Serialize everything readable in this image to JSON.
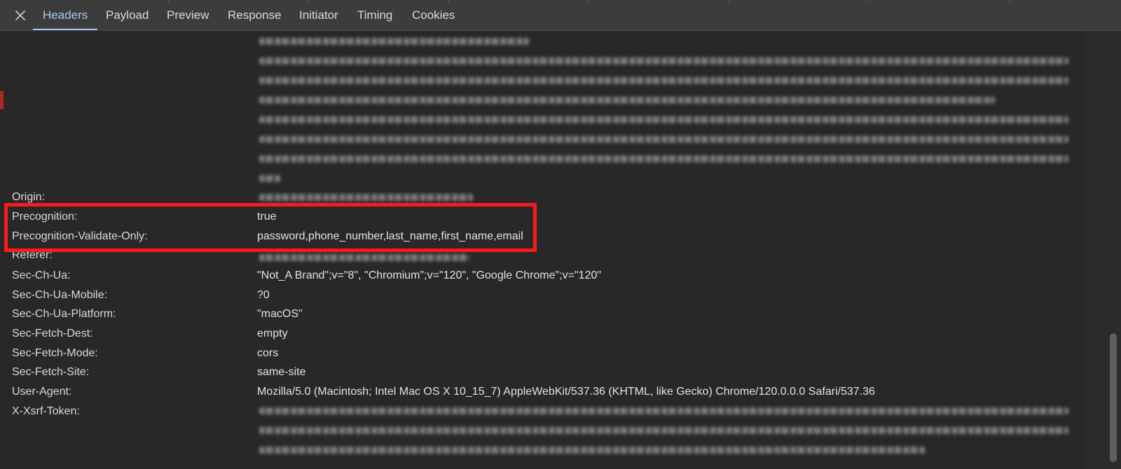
{
  "tabs": {
    "close_icon": "close-icon",
    "items": [
      {
        "label": "Headers",
        "active": true
      },
      {
        "label": "Payload"
      },
      {
        "label": "Preview"
      },
      {
        "label": "Response"
      },
      {
        "label": "Initiator"
      },
      {
        "label": "Timing"
      },
      {
        "label": "Cookies"
      }
    ]
  },
  "headers": {
    "origin": {
      "name": "Origin:",
      "value_redacted": true
    },
    "precognition": {
      "name": "Precognition:",
      "value": "true"
    },
    "precognition_validate_only": {
      "name": "Precognition-Validate-Only:",
      "value": "password,phone_number,last_name,first_name,email"
    },
    "referer": {
      "name": "Referer:",
      "value_redacted": true
    },
    "sec_ch_ua": {
      "name": "Sec-Ch-Ua:",
      "value": "\"Not_A Brand\";v=\"8\", \"Chromium\";v=\"120\", \"Google Chrome\";v=\"120\""
    },
    "sec_ch_ua_mobile": {
      "name": "Sec-Ch-Ua-Mobile:",
      "value": "?0"
    },
    "sec_ch_ua_platform": {
      "name": "Sec-Ch-Ua-Platform:",
      "value": "\"macOS\""
    },
    "sec_fetch_dest": {
      "name": "Sec-Fetch-Dest:",
      "value": "empty"
    },
    "sec_fetch_mode": {
      "name": "Sec-Fetch-Mode:",
      "value": "cors"
    },
    "sec_fetch_site": {
      "name": "Sec-Fetch-Site:",
      "value": "same-site"
    },
    "user_agent": {
      "name": "User-Agent:",
      "value": "Mozilla/5.0 (Macintosh; Intel Mac OS X 10_15_7) AppleWebKit/537.36 (KHTML, like Gecko) Chrome/120.0.0.0 Safari/537.36"
    },
    "x_xsrf_token": {
      "name": "X-Xsrf-Token:",
      "value_redacted": true
    }
  },
  "colors": {
    "background": "#282828",
    "tab_active": "#a8c7fa",
    "highlight_box": "#ff1a1a"
  }
}
